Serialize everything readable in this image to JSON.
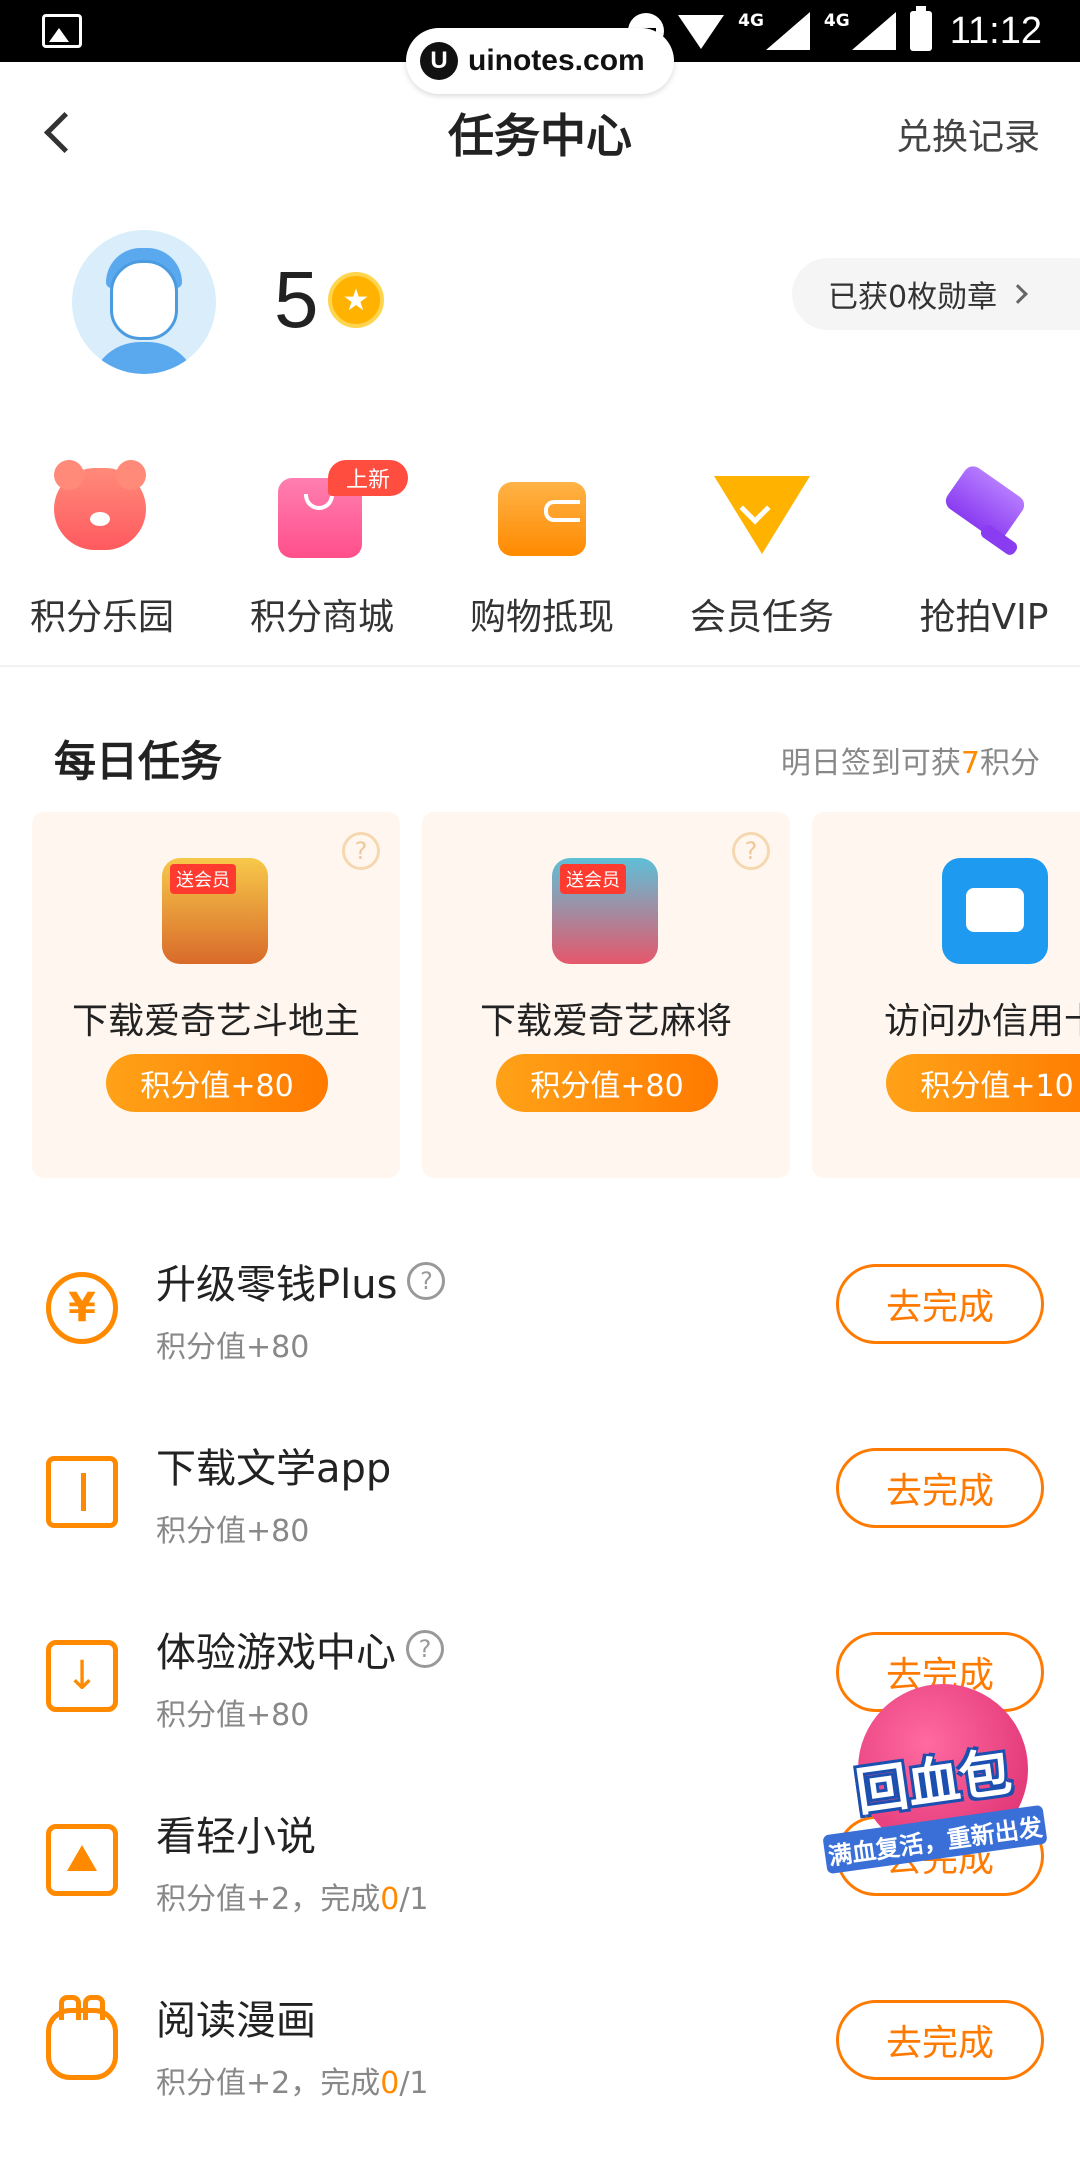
{
  "status_bar": {
    "time": "11:12",
    "network_1": "4G",
    "network_2": "4G",
    "watermark_logo": "U",
    "watermark": "uinotes.com"
  },
  "header": {
    "title": "任务中心",
    "right_link": "兑换记录"
  },
  "profile": {
    "points": "5",
    "coin_icon": "star-coin-icon",
    "medals": "已获0枚勋章"
  },
  "menu": [
    {
      "label": "积分乐园",
      "icon": "bear-icon"
    },
    {
      "label": "积分商城",
      "icon": "shopping-bag-icon",
      "badge": "上新"
    },
    {
      "label": "购物抵现",
      "icon": "wallet-icon"
    },
    {
      "label": "会员任务",
      "icon": "diamond-vip-icon"
    },
    {
      "label": "抢拍VIP",
      "icon": "auction-hammer-icon"
    }
  ],
  "daily": {
    "title": "每日任务",
    "hint_prefix": "明日签到可获",
    "hint_value": "7",
    "hint_suffix": "积分",
    "cards": [
      {
        "title": "下载爱奇艺斗地主",
        "button": "积分值+80",
        "icon_tag": "送会员",
        "help": "?"
      },
      {
        "title": "下载爱奇艺麻将",
        "button": "积分值+80",
        "icon_tag": "送会员",
        "help": "?"
      },
      {
        "title": "访问办信用卡",
        "button": "积分值+10"
      }
    ]
  },
  "tasks": [
    {
      "name": "升级零钱Plus",
      "sub": "积分值+80",
      "button": "去完成",
      "icon": "yen-icon",
      "help": "?"
    },
    {
      "name": "下载文学app",
      "sub": "积分值+80",
      "button": "去完成",
      "icon": "book-icon"
    },
    {
      "name": "体验游戏中心",
      "sub": "积分值+80",
      "button": "去完成",
      "icon": "download-icon",
      "help": "?"
    },
    {
      "name": "看轻小说",
      "sub_prefix": "积分值+2，完成",
      "progress_done": "0",
      "progress_total": "/1",
      "button": "去完成",
      "icon": "novel-icon"
    },
    {
      "name": "阅读漫画",
      "sub_prefix": "积分值+2，完成",
      "progress_done": "0",
      "progress_total": "/1",
      "button": "去完成",
      "icon": "bunny-comic-icon"
    }
  ],
  "promo": {
    "title": "回血包",
    "subtitle": "满血复活，重新出发"
  },
  "colors": {
    "accent": "#ff7a00",
    "card_bg": "#fff7ef",
    "badge": "#ff4d3f"
  }
}
